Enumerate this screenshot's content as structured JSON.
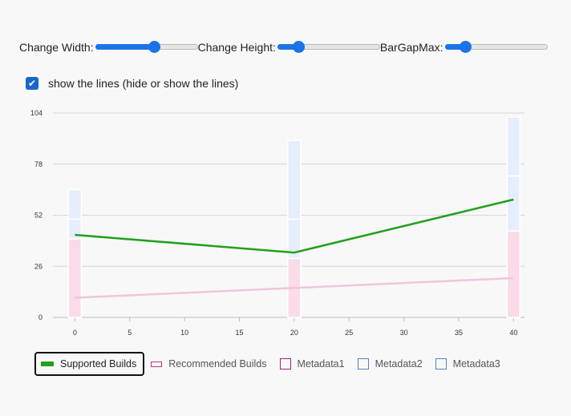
{
  "controls": {
    "width_label": "Change Width:",
    "height_label": "Change Height:",
    "gap_label": "BarGapMax:",
    "width_value": 0.57,
    "height_value": 0.2,
    "gap_value": 0.2
  },
  "checkbox": {
    "label": "show the lines (hide or show the lines)",
    "checked": true
  },
  "colors": {
    "accent": "#1a73e8",
    "supported": "#22a01c",
    "recommended": "#f2c4dc",
    "metadata1": "#f9dbe9",
    "metadata2": "#e7eefb",
    "metadata3": "#e5eefa"
  },
  "chart_data": {
    "type": "bar",
    "x": [
      0,
      20,
      40
    ],
    "xlim": [
      -2,
      41
    ],
    "ylim": [
      0,
      104
    ],
    "xticks": [
      "0",
      "5",
      "10",
      "15",
      "20",
      "25",
      "30",
      "35",
      "40"
    ],
    "yticks": [
      "0",
      "26",
      "52",
      "78",
      "104"
    ],
    "grid": true,
    "stacked_series": [
      {
        "name": "Metadata1",
        "values": [
          40,
          30,
          44
        ]
      },
      {
        "name": "Metadata2",
        "values": [
          10,
          20,
          28
        ]
      },
      {
        "name": "Metadata3",
        "values": [
          15,
          40,
          30
        ]
      }
    ],
    "line_series": [
      {
        "name": "Supported Builds",
        "values": [
          42,
          33,
          60
        ]
      },
      {
        "name": "Recommended Builds",
        "values": [
          10,
          15,
          20
        ]
      }
    ],
    "legend": [
      "Supported Builds",
      "Recommended Builds",
      "Metadata1",
      "Metadata2",
      "Metadata3"
    ],
    "legend_placement": "bottom-left"
  }
}
